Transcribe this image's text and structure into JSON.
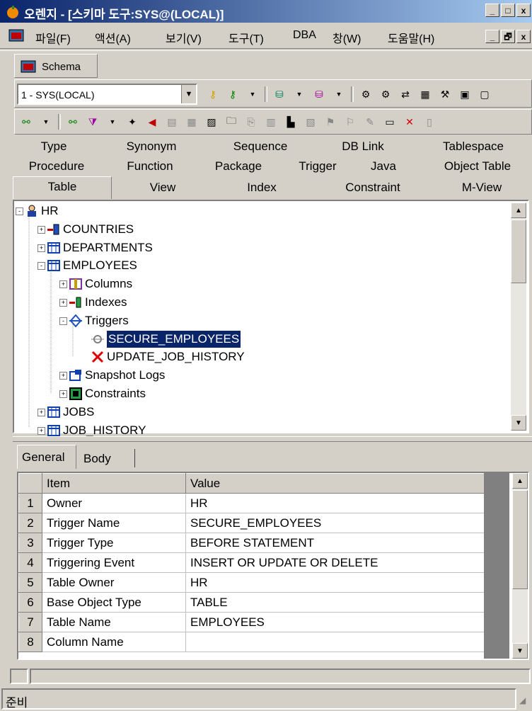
{
  "window": {
    "title": "오렌지 - [스키마 도구:SYS@(LOCAL)]",
    "controls": [
      "_",
      "□",
      "x"
    ],
    "mdi_controls": [
      "_",
      "🗗",
      "x"
    ]
  },
  "menu": [
    "파일(F)",
    "액션(A)",
    "보기(V)",
    "도구(T)",
    "DBA",
    "창(W)",
    "도움말(H)"
  ],
  "schema_tab": "Schema",
  "connection": "1 - SYS(LOCAL)",
  "object_tabs": {
    "row1": [
      "Type",
      "Synonym",
      "Sequence",
      "DB Link",
      "Tablespace"
    ],
    "row2": [
      "Procedure",
      "Function",
      "Package",
      "Trigger",
      "Java",
      "Object Table"
    ],
    "row3": [
      "Table",
      "View",
      "Index",
      "Constraint",
      "M-View"
    ]
  },
  "tree": [
    {
      "label": "HR",
      "indent": 0,
      "pm": "-",
      "icon": "user-icon"
    },
    {
      "label": "COUNTRIES",
      "indent": 1,
      "pm": "+",
      "icon": "iot-table-icon"
    },
    {
      "label": "DEPARTMENTS",
      "indent": 1,
      "pm": "+",
      "icon": "table-icon"
    },
    {
      "label": "EMPLOYEES",
      "indent": 1,
      "pm": "-",
      "icon": "table-icon"
    },
    {
      "label": "Columns",
      "indent": 2,
      "pm": "+",
      "icon": "columns-icon"
    },
    {
      "label": "Indexes",
      "indent": 2,
      "pm": "+",
      "icon": "index-icon"
    },
    {
      "label": "Triggers",
      "indent": 2,
      "pm": "-",
      "icon": "trigger-icon"
    },
    {
      "label": "SECURE_EMPLOYEES",
      "indent": 3,
      "pm": "",
      "icon": "trigger-enabled-icon",
      "selected": true
    },
    {
      "label": "UPDATE_JOB_HISTORY",
      "indent": 3,
      "pm": "",
      "icon": "trigger-disabled-icon"
    },
    {
      "label": "Snapshot Logs",
      "indent": 2,
      "pm": "+",
      "icon": "snapshot-log-icon"
    },
    {
      "label": "Constraints",
      "indent": 2,
      "pm": "+",
      "icon": "constraint-icon"
    },
    {
      "label": "JOBS",
      "indent": 1,
      "pm": "+",
      "icon": "table-icon"
    },
    {
      "label": "JOB_HISTORY",
      "indent": 1,
      "pm": "+",
      "icon": "table-icon"
    }
  ],
  "detail_tabs": [
    "General",
    "Body"
  ],
  "grid": {
    "headers": [
      "Item",
      "Value"
    ],
    "rows": [
      {
        "n": "1",
        "item": "Owner",
        "value": "HR"
      },
      {
        "n": "2",
        "item": "Trigger Name",
        "value": "SECURE_EMPLOYEES"
      },
      {
        "n": "3",
        "item": "Trigger Type",
        "value": "BEFORE STATEMENT"
      },
      {
        "n": "4",
        "item": "Triggering Event",
        "value": "INSERT OR UPDATE OR DELETE"
      },
      {
        "n": "5",
        "item": "Table Owner",
        "value": "HR"
      },
      {
        "n": "6",
        "item": "Base Object Type",
        "value": "TABLE"
      },
      {
        "n": "7",
        "item": "Table Name",
        "value": "EMPLOYEES"
      },
      {
        "n": "8",
        "item": "Column Name",
        "value": ""
      }
    ]
  },
  "status": "준비",
  "colors": {
    "titlebar_start": "#0a246a",
    "titlebar_end": "#a6caf0",
    "selection": "#0a246a",
    "face": "#d4d0c8"
  }
}
